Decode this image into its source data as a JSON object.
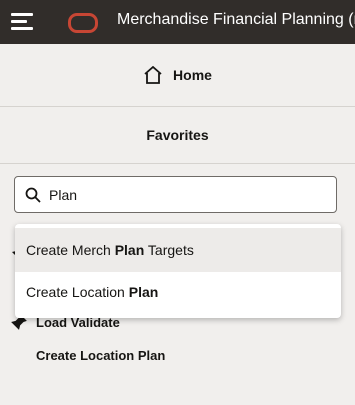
{
  "topbar": {
    "title": "Merchandise Financial Planning (mf"
  },
  "nav": {
    "home_label": "Home",
    "favorites_label": "Favorites"
  },
  "search": {
    "value": "Plan"
  },
  "dropdown": {
    "items": [
      {
        "pre": "Create Merch ",
        "match": "Plan",
        "post": " Targets"
      },
      {
        "pre": "Create Location ",
        "match": "Plan",
        "post": ""
      }
    ]
  },
  "favorites": {
    "items": [
      {
        "label": "Load Validate"
      },
      {
        "label": "Create Location Plan"
      }
    ]
  },
  "colors": {
    "topbar": "#312d2a",
    "logo": "#c74634",
    "background": "#f1efed"
  },
  "icons": [
    "menu-icon",
    "oracle-logo-icon",
    "home-icon",
    "search-icon",
    "pin-icon"
  ]
}
